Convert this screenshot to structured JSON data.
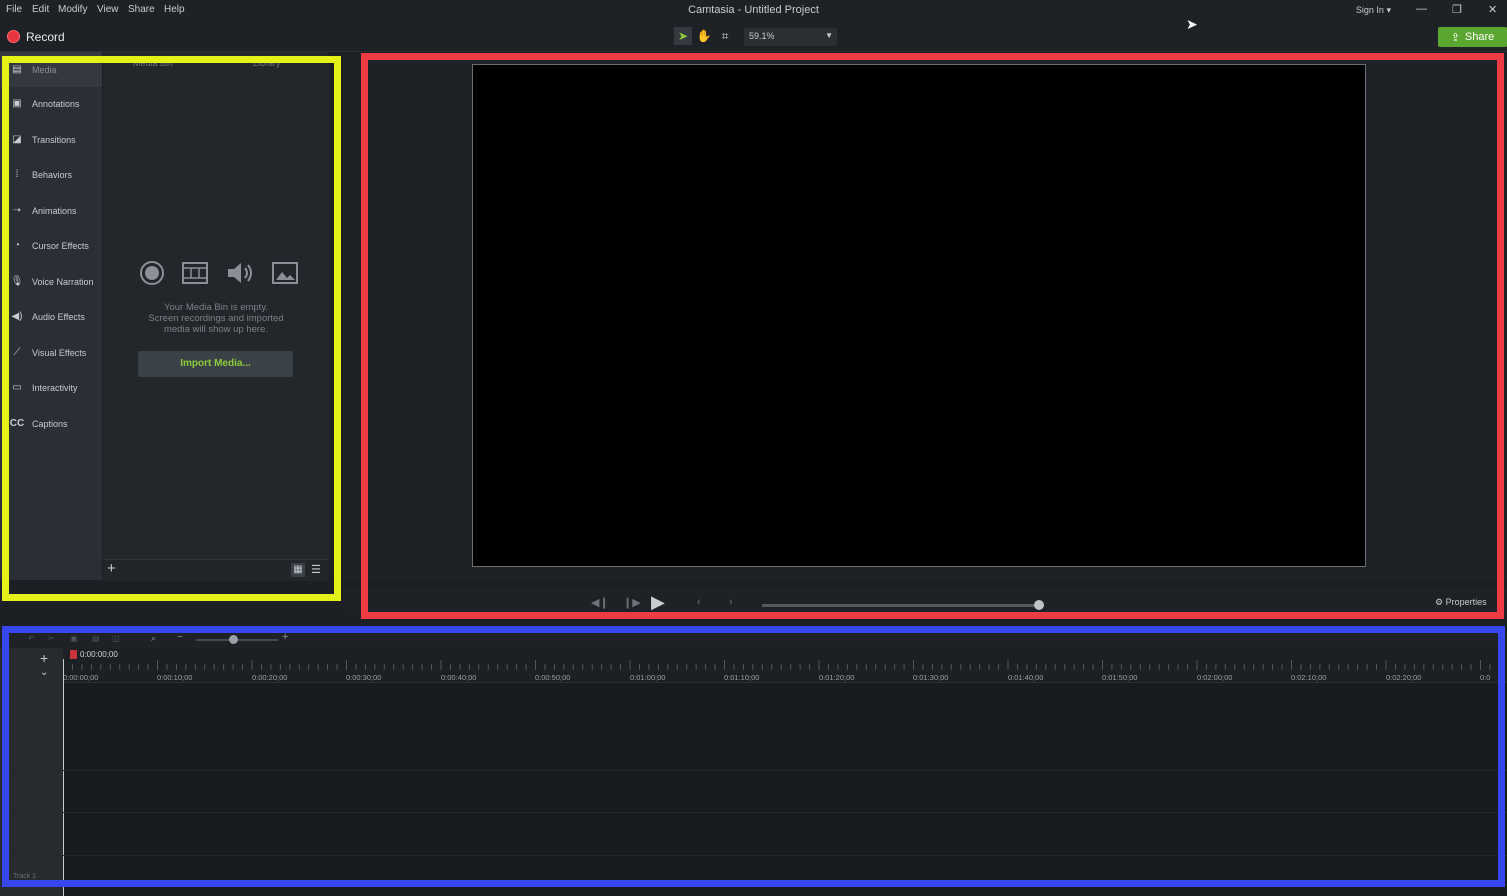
{
  "menu": [
    "File",
    "Edit",
    "Modify",
    "View",
    "Share",
    "Help"
  ],
  "app_title": "Camtasia - Untitled Project",
  "signin": "Sign In",
  "toolbar": {
    "record_label": "Record",
    "zoom": "59.1%",
    "share_label": "Share"
  },
  "nav": [
    {
      "label": "Media",
      "icon": "film-strip-icon"
    },
    {
      "label": "Annotations",
      "icon": "callout-icon"
    },
    {
      "label": "Transitions",
      "icon": "transition-icon"
    },
    {
      "label": "Behaviors",
      "icon": "behaviors-icon"
    },
    {
      "label": "Animations",
      "icon": "animation-icon"
    },
    {
      "label": "Cursor Effects",
      "icon": "cursor-icon"
    },
    {
      "label": "Voice Narration",
      "icon": "microphone-icon"
    },
    {
      "label": "Audio Effects",
      "icon": "speaker-icon"
    },
    {
      "label": "Visual Effects",
      "icon": "magic-wand-icon"
    },
    {
      "label": "Interactivity",
      "icon": "interactive-icon"
    },
    {
      "label": "Captions",
      "icon": "cc-icon"
    }
  ],
  "media_panel": {
    "tabs": [
      "Media Bin",
      "Library"
    ],
    "empty_line1": "Your Media Bin is empty.",
    "empty_line2": "Screen recordings and imported",
    "empty_line3": "media will show up here.",
    "import_label": "Import Media..."
  },
  "playback": {
    "properties_label": "Properties"
  },
  "timeline": {
    "playhead_time": "0:00:00;00",
    "ticks": [
      "0:00:00;00",
      "0:00:10;00",
      "0:00:20;00",
      "0:00:30;00",
      "0:00:40;00",
      "0:00:50;00",
      "0:01:00;00",
      "0:01:10;00",
      "0:01:20;00",
      "0:01:30;00",
      "0:01:40;00",
      "0:01:50;00",
      "0:02:00;00",
      "0:02:10;00",
      "0:02:20;00",
      "0:0"
    ],
    "track_label": "Track 1"
  },
  "colors": {
    "highlight_yellow": "#e5f218",
    "highlight_red": "#ef3b44",
    "highlight_blue": "#3747f0",
    "accent_green": "#5aa630"
  }
}
